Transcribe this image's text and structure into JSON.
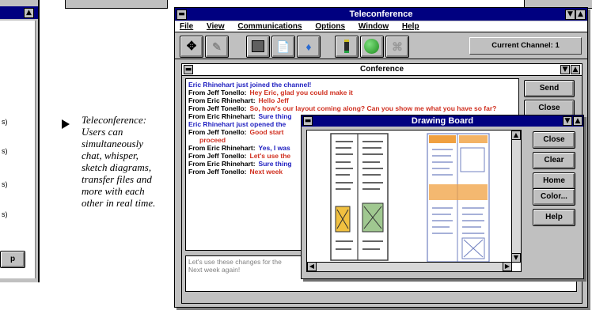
{
  "left_panel": {
    "button_label": "p",
    "items": [
      "s)",
      "s)",
      "s)",
      "s)"
    ]
  },
  "caption": {
    "text": "Teleconference: Users can simultaneously chat, whisper, sketch diagrams, transfer files and more with each other in real time."
  },
  "teleconference": {
    "title": "Teleconference",
    "menu": [
      "File",
      "View",
      "Communications",
      "Options",
      "Window",
      "Help"
    ],
    "toolbar_icons": [
      "move-icon",
      "pen-icon",
      "drawing-board-icon",
      "document-icon",
      "user-icon",
      "phone-icon",
      "globe-icon",
      "map-icon"
    ],
    "current_channel": "Current Channel: 1"
  },
  "conference": {
    "title": "Conference",
    "send_label": "Send",
    "close_label": "Close",
    "lines": [
      {
        "prefix": "Eric Rhinehart just joined the channel!",
        "text": "",
        "color": "#2020c0"
      },
      {
        "prefix": "From Jeff Tonello:",
        "text": "Hey Eric, glad you could make it",
        "color": "#d03020"
      },
      {
        "prefix": "From Eric Rhinehart:",
        "text": "Hello Jeff",
        "color": "#d03020"
      },
      {
        "prefix": "From Jeff Tonello:",
        "text": "So, how's our layout coming along? Can you show me what you have so far?",
        "color": "#d03020"
      },
      {
        "prefix": "From Eric Rhinehart:",
        "text": "Sure thing",
        "color": "#2020c0"
      },
      {
        "prefix": "Eric Rhinehart just opened the",
        "text": "",
        "color": "#2020c0"
      },
      {
        "prefix": "From Jeff Tonello:",
        "text": "Good start",
        "color": "#d03020"
      },
      {
        "prefix": "",
        "text": "proceed",
        "color": "#d03020"
      },
      {
        "prefix": "From Eric Rhinehart:",
        "text": "Yes, I was",
        "color": "#2020c0"
      },
      {
        "prefix": "From Jeff Tonello:",
        "text": "Let's use the",
        "color": "#d03020"
      },
      {
        "prefix": "From Eric Rhinehart:",
        "text": "Sure thing",
        "color": "#2020c0"
      },
      {
        "prefix": "From Jeff Tonello:",
        "text": "Next week",
        "color": "#d03020"
      }
    ],
    "input_lines": [
      "Let's use these changes for the",
      "Next week again!"
    ]
  },
  "drawing_board": {
    "title": "Drawing Board",
    "buttons": [
      "Close",
      "Clear",
      "Home",
      "Color...",
      "Help"
    ]
  },
  "colors": {
    "title_bar": "#000080",
    "window_gray": "#c0c0c0",
    "chat_blue": "#2020c0",
    "chat_red": "#d03020",
    "sketch_orange": "#f0a040",
    "sketch_green": "#a0c890"
  }
}
